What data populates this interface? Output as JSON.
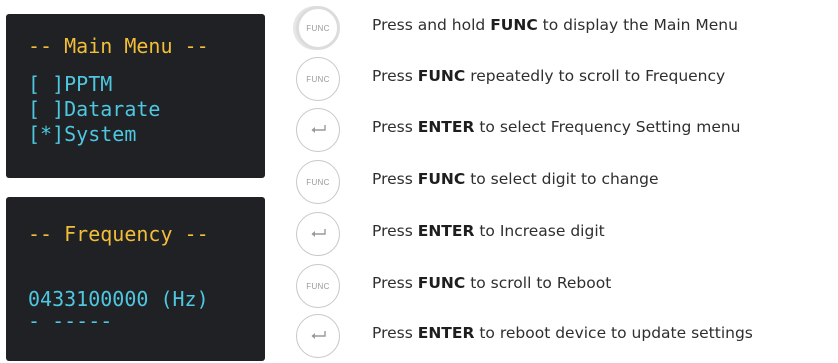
{
  "main_menu_screen": {
    "title": "-- Main Menu --",
    "items": [
      "[ ]PPTM",
      "[ ]Datarate",
      "[*]System"
    ]
  },
  "frequency_screen": {
    "title": "-- Frequency --",
    "value": "0433100000 (Hz)",
    "cursor": "- -----"
  },
  "buttons": {
    "func_label": "FUNC",
    "enter_icon": "enter-arrow-icon"
  },
  "steps": [
    {
      "button": "FUNC",
      "pre": "Press and hold ",
      "key": "FUNC",
      "post": " to display the Main Menu"
    },
    {
      "button": "FUNC",
      "pre": "Press ",
      "key": "FUNC",
      "post": " repeatedly to scroll to Frequency"
    },
    {
      "button": "ENTER",
      "pre": "Press ",
      "key": "ENTER",
      "post": " to select Frequency Setting menu"
    },
    {
      "button": "FUNC",
      "pre": "Press ",
      "key": "FUNC",
      "post": " to select digit to change"
    },
    {
      "button": "ENTER",
      "pre": "Press ",
      "key": "ENTER",
      "post": " to Increase digit"
    },
    {
      "button": "FUNC",
      "pre": "Press ",
      "key": "FUNC",
      "post": " to scroll to Reboot"
    },
    {
      "button": "ENTER",
      "pre": "Press ",
      "key": "ENTER",
      "post": " to reboot device to update settings"
    }
  ],
  "colors": {
    "screen_bg": "#1f2124",
    "title_color": "#f2bd39",
    "item_color": "#4ec7e0"
  }
}
